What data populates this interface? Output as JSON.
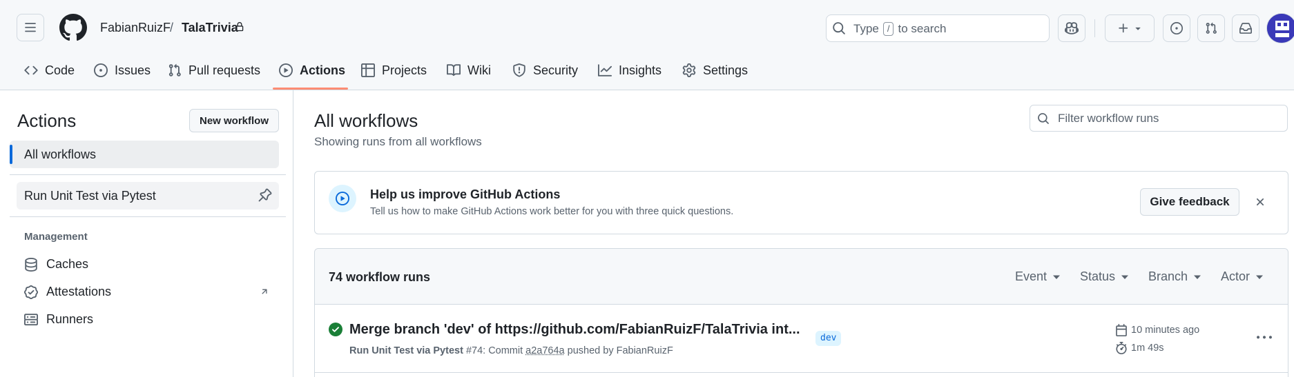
{
  "repo": {
    "owner": "FabianRuizF",
    "separator": "/",
    "name": "TalaTrivia"
  },
  "search": {
    "prefix": "Type",
    "key": "/",
    "suffix": "to search"
  },
  "tabs": [
    {
      "label": "Code",
      "icon": "code-icon"
    },
    {
      "label": "Issues",
      "icon": "issue-icon"
    },
    {
      "label": "Pull requests",
      "icon": "pull-request-icon"
    },
    {
      "label": "Actions",
      "icon": "play-icon",
      "active": true
    },
    {
      "label": "Projects",
      "icon": "table-icon"
    },
    {
      "label": "Wiki",
      "icon": "book-icon"
    },
    {
      "label": "Security",
      "icon": "shield-icon"
    },
    {
      "label": "Insights",
      "icon": "graph-icon"
    },
    {
      "label": "Settings",
      "icon": "gear-icon"
    }
  ],
  "sidebar": {
    "title": "Actions",
    "new_workflow": "New workflow",
    "all_workflows": "All workflows",
    "workflows": [
      {
        "label": "Run Unit Test via Pytest"
      }
    ],
    "management": {
      "title": "Management",
      "items": [
        {
          "label": "Caches",
          "icon": "database-icon"
        },
        {
          "label": "Attestations",
          "icon": "verified-icon"
        },
        {
          "label": "Runners",
          "icon": "server-icon"
        }
      ]
    }
  },
  "main": {
    "title": "All workflows",
    "subtitle": "Showing runs from all workflows",
    "filter_placeholder": "Filter workflow runs",
    "banner": {
      "title": "Help us improve GitHub Actions",
      "text": "Tell us how to make GitHub Actions work better for you with three quick questions.",
      "button": "Give feedback"
    },
    "runs": {
      "count_label": "74 workflow runs",
      "filters": [
        "Event",
        "Status",
        "Branch",
        "Actor"
      ],
      "items": [
        {
          "title": "Merge branch 'dev' of https://github.com/FabianRuizF/TalaTrivia int...",
          "branch": "dev",
          "workflow": "Run Unit Test via Pytest",
          "number": "#74",
          "commit_prefix": ": Commit",
          "commit": "a2a764a",
          "pushed_by": "pushed by FabianRuizF",
          "time": "10 minutes ago",
          "duration": "1m 49s",
          "status": "success"
        }
      ]
    }
  },
  "colors": {
    "accent": "#0969da",
    "success": "#1a7f37",
    "tab_underline": "#fd8c73",
    "avatar": "#3a39b8"
  }
}
